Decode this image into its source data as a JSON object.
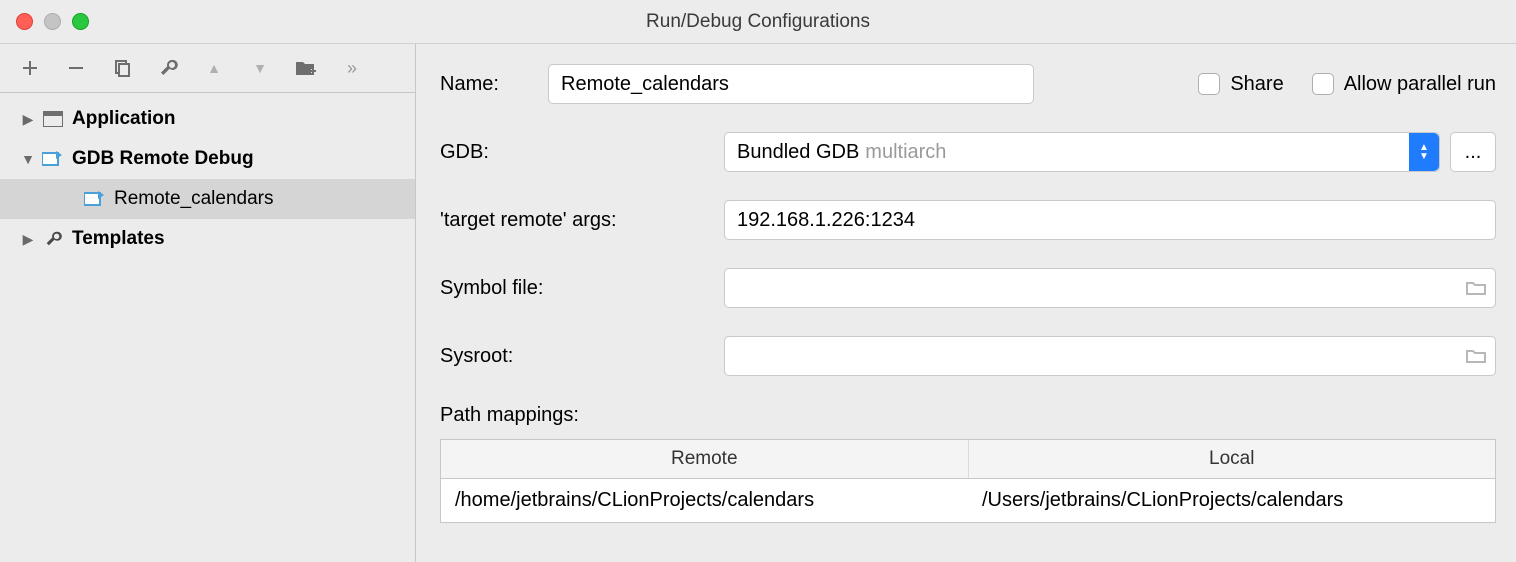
{
  "window": {
    "title": "Run/Debug Configurations"
  },
  "sidebar": {
    "items": [
      {
        "label": "Application",
        "expanded": false,
        "bold": true
      },
      {
        "label": "GDB Remote Debug",
        "expanded": true,
        "bold": true
      },
      {
        "label": "Remote_calendars",
        "child": true,
        "selected": true
      },
      {
        "label": "Templates",
        "expanded": false,
        "bold": true
      }
    ]
  },
  "form": {
    "name_label": "Name:",
    "name_value": "Remote_calendars",
    "share_label": "Share",
    "allow_parallel_label": "Allow parallel run",
    "gdb_label": "GDB:",
    "gdb_value": "Bundled GDB",
    "gdb_hint": "multiarch",
    "target_args_label": "'target remote' args:",
    "target_args_value": "192.168.1.226:1234",
    "symbol_label": "Symbol file:",
    "symbol_value": "",
    "sysroot_label": "Sysroot:",
    "sysroot_value": "",
    "path_mappings_label": "Path mappings:",
    "table": {
      "col_remote": "Remote",
      "col_local": "Local",
      "rows": [
        {
          "remote": "/home/jetbrains/CLionProjects/calendars",
          "local": "/Users/jetbrains/CLionProjects/calendars"
        }
      ]
    }
  }
}
